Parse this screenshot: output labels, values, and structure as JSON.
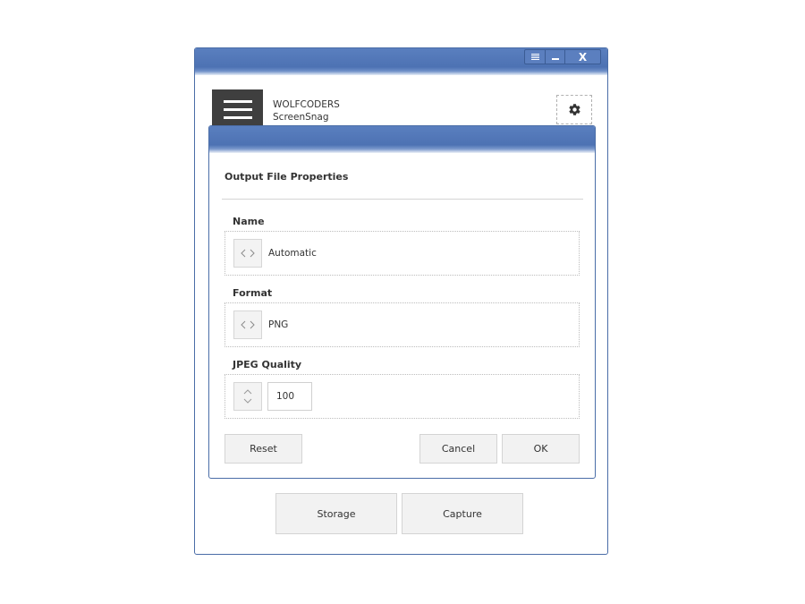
{
  "window": {
    "controls": {
      "menu_icon": "menu-icon",
      "minimize_icon": "minimize-icon",
      "close_label": "X"
    },
    "accent_color": "#4d72b3"
  },
  "header": {
    "brand_line1": "WOLFCODERS",
    "brand_line2": "ScreenSnag",
    "settings_icon": "gear-icon"
  },
  "dialog": {
    "title": "Output File Properties",
    "fields": {
      "name": {
        "label": "Name",
        "value": "Automatic"
      },
      "format": {
        "label": "Format",
        "value": "PNG"
      },
      "jpeg_quality": {
        "label": "JPEG Quality",
        "value": "100"
      }
    },
    "buttons": {
      "reset": "Reset",
      "cancel": "Cancel",
      "ok": "OK"
    }
  },
  "main_buttons": {
    "storage": "Storage",
    "capture": "Capture"
  }
}
